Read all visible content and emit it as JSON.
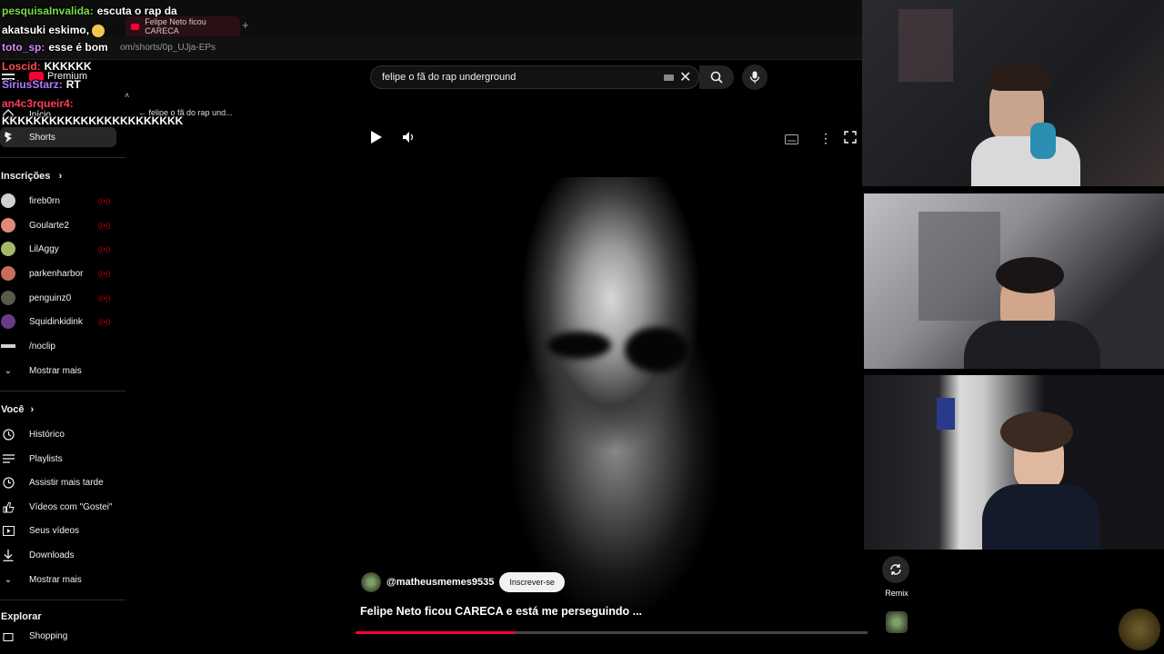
{
  "browser": {
    "tab_title": "Felipe Neto ficou CARECA",
    "address_text": "om/shorts/0p_UJja-EPs"
  },
  "masthead": {
    "logo_label": "Premium",
    "search_value": "felipe o fã do rap underground"
  },
  "sidebar": {
    "top_items": [
      {
        "label": "Início"
      },
      {
        "label": "Shorts"
      }
    ],
    "back_label": "felipe o fã do rap und...",
    "subscriptions_heading": "Inscrições",
    "subscriptions": [
      {
        "label": "fireb0rn",
        "color": "#cfcfcf"
      },
      {
        "label": "Goularte2",
        "color": "#e0887a"
      },
      {
        "label": "LilAggy",
        "color": "#a8b86a"
      },
      {
        "label": "parkenharbor",
        "color": "#c96e5a"
      },
      {
        "label": "penguinz0",
        "color": "#5a5a4a"
      },
      {
        "label": "Squidinkidink",
        "color": "#6a3a8a"
      },
      {
        "label": "/noclip",
        "color": "#cfcfcf"
      }
    ],
    "show_more_subs": "Mostrar mais",
    "you_heading": "Você",
    "you_items": [
      {
        "label": "Histórico",
        "icon": "history-icon"
      },
      {
        "label": "Playlists",
        "icon": "playlists-icon"
      },
      {
        "label": "Assistir mais tarde",
        "icon": "watch-later-icon"
      },
      {
        "label": "Vídeos com \"Gostei\"",
        "icon": "thumbs-up-icon"
      },
      {
        "label": "Seus vídeos",
        "icon": "your-videos-icon"
      },
      {
        "label": "Downloads",
        "icon": "download-icon"
      }
    ],
    "show_more_you": "Mostrar mais",
    "explore_heading": "Explorar",
    "explore_items": [
      {
        "label": "Shopping"
      }
    ]
  },
  "video": {
    "channel": "@matheusmemes9535",
    "subscribe_label": "Inscrever-se",
    "title": "Felipe Neto ficou CARECA e está me perseguindo ...",
    "progress_fraction": 0.31
  },
  "remix": {
    "label": "Remix"
  },
  "chat": [
    {
      "user": "pesquisaInvalida:",
      "user_color": "#7ddc4a",
      "text": "escuta o rap da"
    },
    {
      "user": "",
      "user_color": "#ffffff",
      "text": "akatsuki eskimo,"
    },
    {
      "user": "toto_sp:",
      "user_color": "#d98aff",
      "text": "esse é bom"
    },
    {
      "user": "Loscid:",
      "user_color": "#ff4a4a",
      "text": "KKKKKK"
    },
    {
      "user": "SiriusStarz:",
      "user_color": "#b07aff",
      "text": "RT"
    },
    {
      "user": "an4c3rqueir4:",
      "user_color": "#ff3a5a",
      "text": ""
    },
    {
      "user": "",
      "user_color": "#ffffff",
      "text": "KKKKKKKKKKKKKKKKKKKKKKK"
    }
  ],
  "colors": {
    "accent_red": "#ff0033",
    "background": "#000000",
    "sidebar_active": "#272727"
  }
}
